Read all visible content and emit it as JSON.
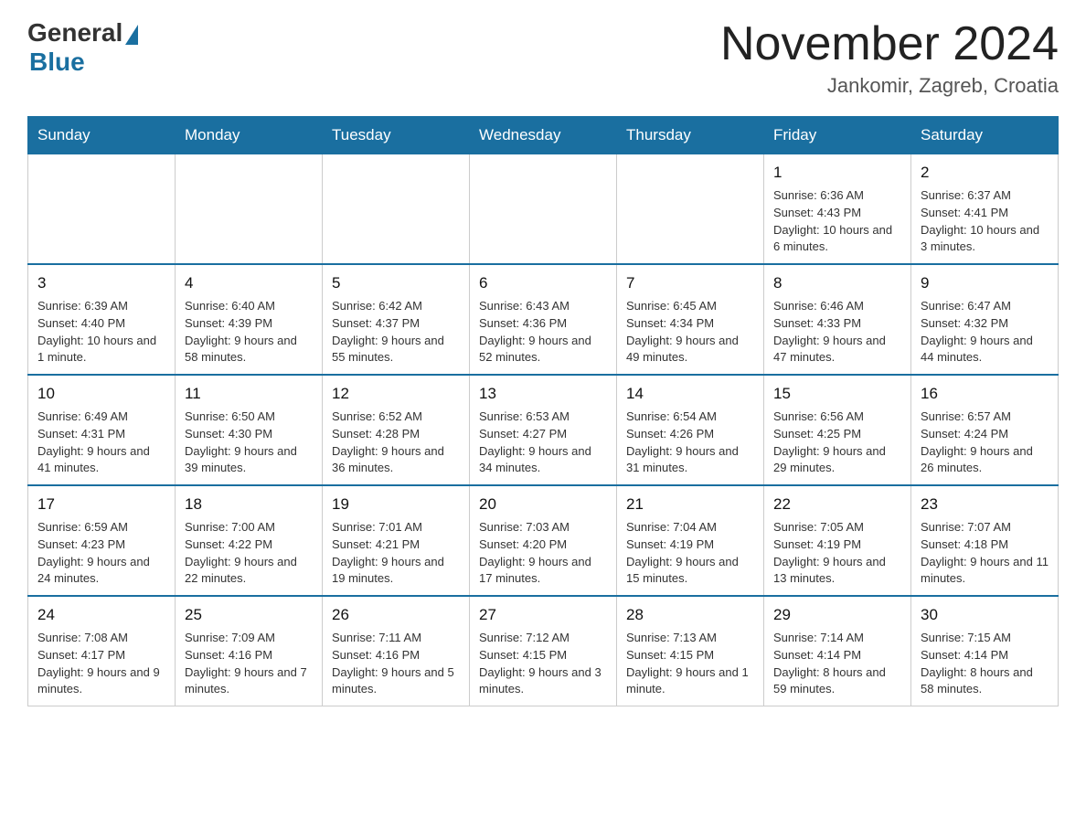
{
  "header": {
    "logo_general": "General",
    "logo_blue": "Blue",
    "month_title": "November 2024",
    "location": "Jankomir, Zagreb, Croatia"
  },
  "calendar": {
    "days_of_week": [
      "Sunday",
      "Monday",
      "Tuesday",
      "Wednesday",
      "Thursday",
      "Friday",
      "Saturday"
    ],
    "weeks": [
      [
        {
          "day": "",
          "info": ""
        },
        {
          "day": "",
          "info": ""
        },
        {
          "day": "",
          "info": ""
        },
        {
          "day": "",
          "info": ""
        },
        {
          "day": "",
          "info": ""
        },
        {
          "day": "1",
          "info": "Sunrise: 6:36 AM\nSunset: 4:43 PM\nDaylight: 10 hours and 6 minutes."
        },
        {
          "day": "2",
          "info": "Sunrise: 6:37 AM\nSunset: 4:41 PM\nDaylight: 10 hours and 3 minutes."
        }
      ],
      [
        {
          "day": "3",
          "info": "Sunrise: 6:39 AM\nSunset: 4:40 PM\nDaylight: 10 hours and 1 minute."
        },
        {
          "day": "4",
          "info": "Sunrise: 6:40 AM\nSunset: 4:39 PM\nDaylight: 9 hours and 58 minutes."
        },
        {
          "day": "5",
          "info": "Sunrise: 6:42 AM\nSunset: 4:37 PM\nDaylight: 9 hours and 55 minutes."
        },
        {
          "day": "6",
          "info": "Sunrise: 6:43 AM\nSunset: 4:36 PM\nDaylight: 9 hours and 52 minutes."
        },
        {
          "day": "7",
          "info": "Sunrise: 6:45 AM\nSunset: 4:34 PM\nDaylight: 9 hours and 49 minutes."
        },
        {
          "day": "8",
          "info": "Sunrise: 6:46 AM\nSunset: 4:33 PM\nDaylight: 9 hours and 47 minutes."
        },
        {
          "day": "9",
          "info": "Sunrise: 6:47 AM\nSunset: 4:32 PM\nDaylight: 9 hours and 44 minutes."
        }
      ],
      [
        {
          "day": "10",
          "info": "Sunrise: 6:49 AM\nSunset: 4:31 PM\nDaylight: 9 hours and 41 minutes."
        },
        {
          "day": "11",
          "info": "Sunrise: 6:50 AM\nSunset: 4:30 PM\nDaylight: 9 hours and 39 minutes."
        },
        {
          "day": "12",
          "info": "Sunrise: 6:52 AM\nSunset: 4:28 PM\nDaylight: 9 hours and 36 minutes."
        },
        {
          "day": "13",
          "info": "Sunrise: 6:53 AM\nSunset: 4:27 PM\nDaylight: 9 hours and 34 minutes."
        },
        {
          "day": "14",
          "info": "Sunrise: 6:54 AM\nSunset: 4:26 PM\nDaylight: 9 hours and 31 minutes."
        },
        {
          "day": "15",
          "info": "Sunrise: 6:56 AM\nSunset: 4:25 PM\nDaylight: 9 hours and 29 minutes."
        },
        {
          "day": "16",
          "info": "Sunrise: 6:57 AM\nSunset: 4:24 PM\nDaylight: 9 hours and 26 minutes."
        }
      ],
      [
        {
          "day": "17",
          "info": "Sunrise: 6:59 AM\nSunset: 4:23 PM\nDaylight: 9 hours and 24 minutes."
        },
        {
          "day": "18",
          "info": "Sunrise: 7:00 AM\nSunset: 4:22 PM\nDaylight: 9 hours and 22 minutes."
        },
        {
          "day": "19",
          "info": "Sunrise: 7:01 AM\nSunset: 4:21 PM\nDaylight: 9 hours and 19 minutes."
        },
        {
          "day": "20",
          "info": "Sunrise: 7:03 AM\nSunset: 4:20 PM\nDaylight: 9 hours and 17 minutes."
        },
        {
          "day": "21",
          "info": "Sunrise: 7:04 AM\nSunset: 4:19 PM\nDaylight: 9 hours and 15 minutes."
        },
        {
          "day": "22",
          "info": "Sunrise: 7:05 AM\nSunset: 4:19 PM\nDaylight: 9 hours and 13 minutes."
        },
        {
          "day": "23",
          "info": "Sunrise: 7:07 AM\nSunset: 4:18 PM\nDaylight: 9 hours and 11 minutes."
        }
      ],
      [
        {
          "day": "24",
          "info": "Sunrise: 7:08 AM\nSunset: 4:17 PM\nDaylight: 9 hours and 9 minutes."
        },
        {
          "day": "25",
          "info": "Sunrise: 7:09 AM\nSunset: 4:16 PM\nDaylight: 9 hours and 7 minutes."
        },
        {
          "day": "26",
          "info": "Sunrise: 7:11 AM\nSunset: 4:16 PM\nDaylight: 9 hours and 5 minutes."
        },
        {
          "day": "27",
          "info": "Sunrise: 7:12 AM\nSunset: 4:15 PM\nDaylight: 9 hours and 3 minutes."
        },
        {
          "day": "28",
          "info": "Sunrise: 7:13 AM\nSunset: 4:15 PM\nDaylight: 9 hours and 1 minute."
        },
        {
          "day": "29",
          "info": "Sunrise: 7:14 AM\nSunset: 4:14 PM\nDaylight: 8 hours and 59 minutes."
        },
        {
          "day": "30",
          "info": "Sunrise: 7:15 AM\nSunset: 4:14 PM\nDaylight: 8 hours and 58 minutes."
        }
      ]
    ]
  }
}
